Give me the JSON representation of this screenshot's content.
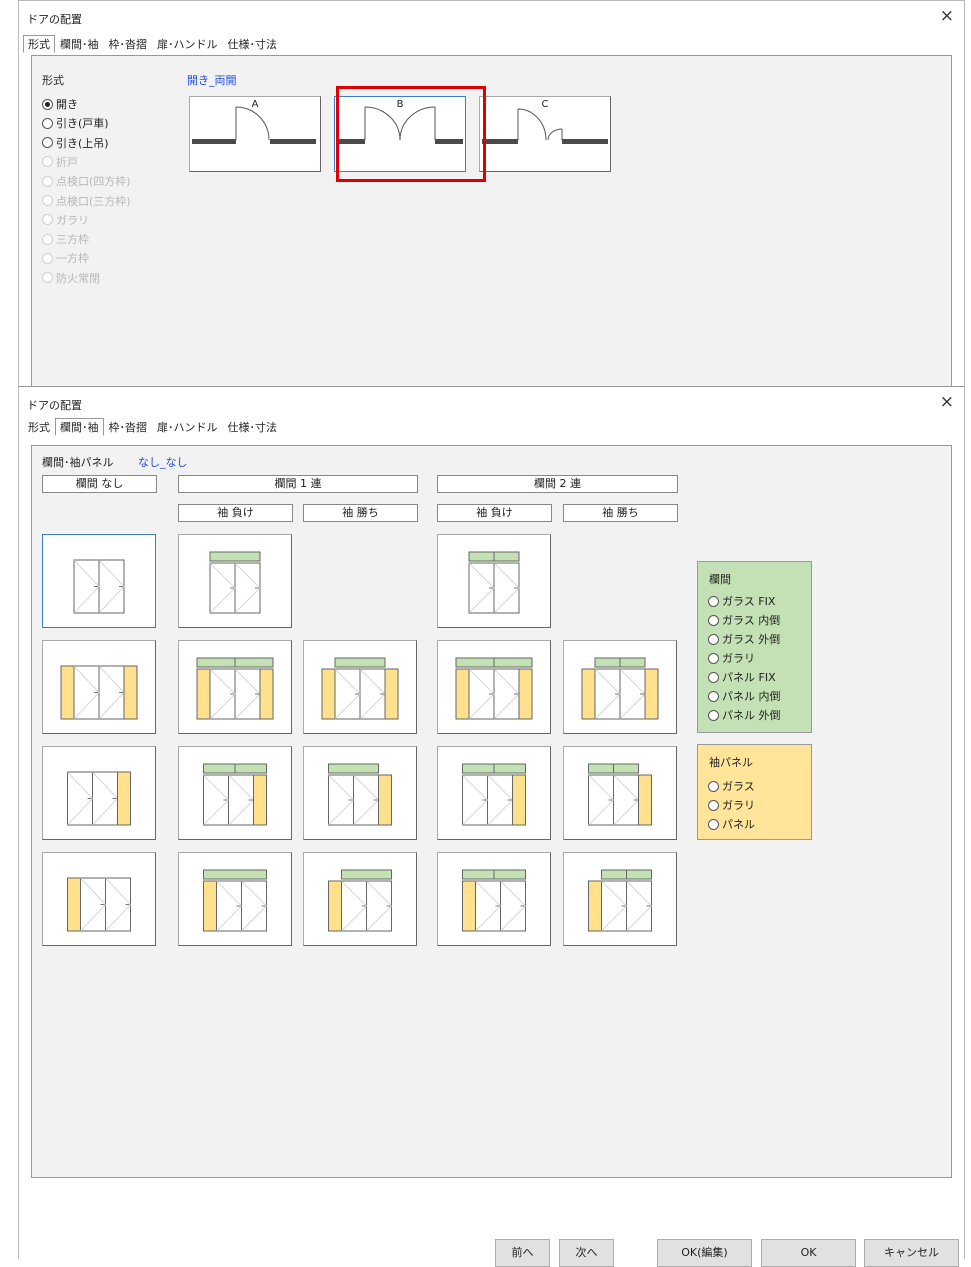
{
  "top_dialog": {
    "title": "ドアの配置",
    "close": "×",
    "tabs": [
      "形式",
      "欄間･袖",
      "枠･沓摺",
      "扉･ハンドル",
      "仕様･寸法"
    ],
    "active_tab": 0,
    "section_label": "形式",
    "current_value": "開き_両開",
    "radio_options": [
      {
        "label": "開き",
        "checked": true,
        "enabled": true
      },
      {
        "label": "引き(戸車)",
        "checked": false,
        "enabled": true
      },
      {
        "label": "引き(上吊)",
        "checked": false,
        "enabled": true
      },
      {
        "label": "折戸",
        "checked": false,
        "enabled": false
      },
      {
        "label": "点検口(四方枠)",
        "checked": false,
        "enabled": false
      },
      {
        "label": "点検口(三方枠)",
        "checked": false,
        "enabled": false
      },
      {
        "label": "ガラリ",
        "checked": false,
        "enabled": false
      },
      {
        "label": "三方枠",
        "checked": false,
        "enabled": false
      },
      {
        "label": "一方枠",
        "checked": false,
        "enabled": false
      },
      {
        "label": "防火常閉",
        "checked": false,
        "enabled": false
      }
    ],
    "door_options": [
      {
        "letter": "A",
        "type": "single",
        "selected": false
      },
      {
        "letter": "B",
        "type": "double",
        "selected": true
      },
      {
        "letter": "C",
        "type": "unequal",
        "selected": false
      }
    ]
  },
  "bottom_dialog": {
    "title": "ドアの配置",
    "close": "×",
    "tabs": [
      "形式",
      "欄間･袖",
      "枠･沓摺",
      "扉･ハンドル",
      "仕様･寸法"
    ],
    "active_tab": 1,
    "section_label": "欄間･袖パネル",
    "current_value": "なし_なし",
    "group_headers": {
      "none": "欄間 なし",
      "one": "欄間 1 連",
      "two": "欄間 2 連"
    },
    "sub_headers": {
      "one_lose": "袖 負け",
      "one_win": "袖 勝ち",
      "two_lose": "袖 負け",
      "two_win": "袖 勝ち"
    },
    "transom_legend": {
      "title": "欄間",
      "options": [
        "ガラス FIX",
        "ガラス 内倒",
        "ガラス 外倒",
        "ガラリ",
        "パネル FIX",
        "パネル 内倒",
        "パネル 外倒"
      ]
    },
    "side_legend": {
      "title": "袖パネル",
      "options": [
        "ガラス",
        "ガラリ",
        "パネル"
      ]
    },
    "buttons": {
      "prev": "前へ",
      "next": "次へ",
      "ok_edit": "OK(編集)",
      "ok": "OK",
      "cancel": "キャンセル"
    },
    "colors": {
      "transom": "#c3e1b4",
      "side_panel": "#ffe08c",
      "selection": "#3d7ec8",
      "accent_text": "#1d4fdc"
    }
  }
}
